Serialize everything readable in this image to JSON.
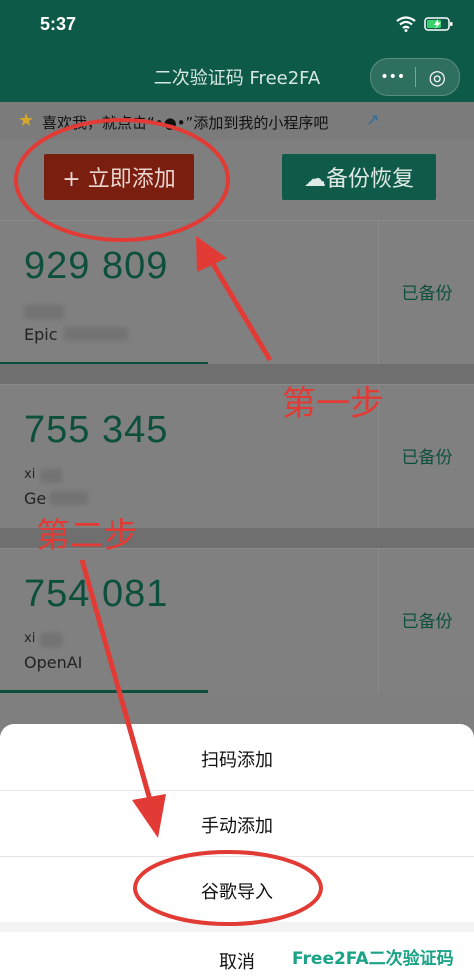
{
  "status_bar": {
    "time": "5:37"
  },
  "nav": {
    "title": "二次验证码 Free2FA",
    "more_icon": "•••",
    "target_icon": "◎"
  },
  "notice": {
    "text": "喜欢我，就点击“•●•”添加到我的小程序吧"
  },
  "actions": {
    "add_label": "+ 立即添加",
    "backup_label": "☁备份恢复"
  },
  "codes": [
    {
      "code": "929 809",
      "account": "",
      "issuer": "Epic",
      "status": "已备份"
    },
    {
      "code": "755 345",
      "account": "xi",
      "issuer": "Ge",
      "status": "已备份"
    },
    {
      "code": "754 081",
      "account": "xi",
      "issuer": "OpenAI",
      "status": "已备份"
    }
  ],
  "sheet": {
    "items": [
      "扫码添加",
      "手动添加",
      "谷歌导入"
    ],
    "cancel": "取消"
  },
  "annotations": {
    "step1": "第一步",
    "step2": "第二步"
  },
  "watermark": "Free2FA二次验证码",
  "colors": {
    "annotation": "#e23b36",
    "brand": "#0e5a48",
    "watermark": "#1aa386"
  }
}
